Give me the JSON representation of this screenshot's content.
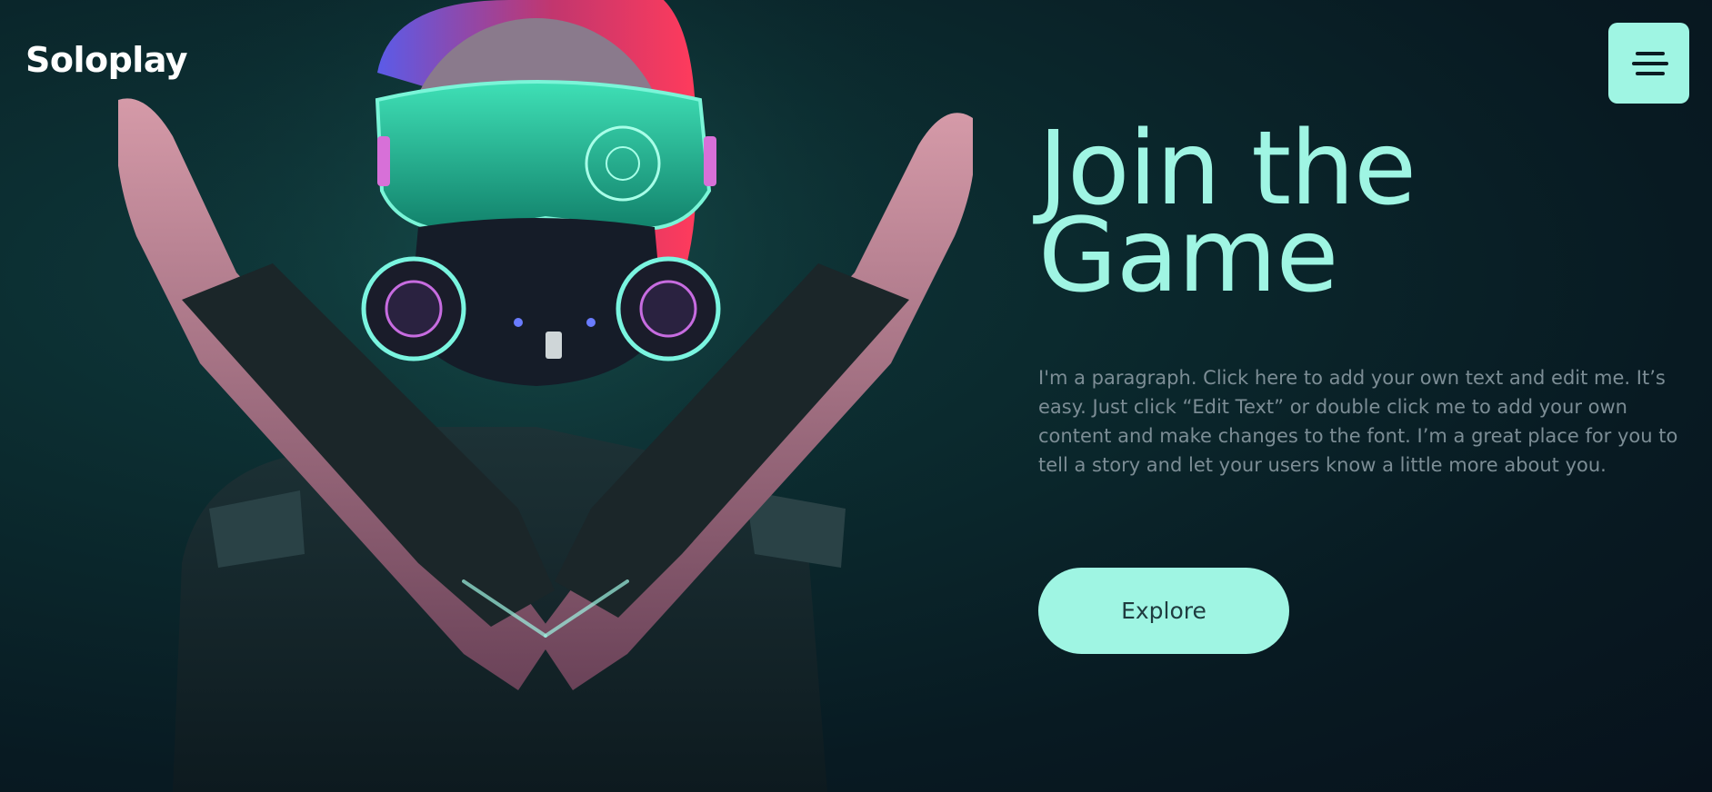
{
  "header": {
    "logo": "Soloplay",
    "menu_icon": "hamburger-menu-icon"
  },
  "hero": {
    "headline_line1": "Join the",
    "headline_line2": "Game",
    "paragraph": "I'm a paragraph. Click here to add your own text and edit me. It’s easy. Just click “Edit Text” or double click me to add your own content and make changes to the font. I’m a great place for you to tell a story and let your users know a little more about you.",
    "cta_label": "Explore"
  },
  "colors": {
    "accent": "#9ff5e3",
    "background": "#081a22",
    "paragraph": "#7c8d95"
  }
}
